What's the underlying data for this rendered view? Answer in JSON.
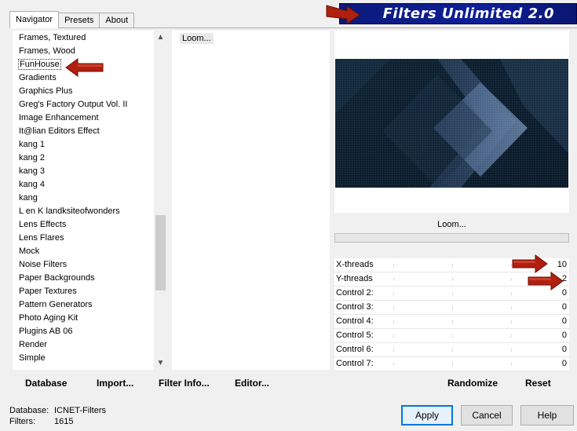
{
  "title": "Filters Unlimited 2.0",
  "tabs": [
    {
      "label": "Navigator",
      "active": true
    },
    {
      "label": "Presets",
      "active": false
    },
    {
      "label": "About",
      "active": false
    }
  ],
  "categories": [
    "Frames, Textured",
    "Frames, Wood",
    "FunHouse",
    "Gradients",
    "Graphics Plus",
    "Greg's Factory Output Vol. II",
    "Image Enhancement",
    "It@lian Editors Effect",
    "kang 1",
    "kang 2",
    "kang 3",
    "kang 4",
    "kang",
    "L en K landksiteofwonders",
    "Lens Effects",
    "Lens Flares",
    "Mock",
    "Noise Filters",
    "Paper Backgrounds",
    "Paper Textures",
    "Pattern Generators",
    "Photo Aging Kit",
    "Plugins AB 06",
    "Render",
    "Simple"
  ],
  "selected_category": "FunHouse",
  "filters": [
    "Loom..."
  ],
  "selected_filter": "Loom...",
  "filter_name_display": "Loom...",
  "controls": [
    {
      "label": "X-threads",
      "value": "10"
    },
    {
      "label": "Y-threads",
      "value": "2"
    },
    {
      "label": "Control 2:",
      "value": "0"
    },
    {
      "label": "Control 3:",
      "value": "0"
    },
    {
      "label": "Control 4:",
      "value": "0"
    },
    {
      "label": "Control 5:",
      "value": "0"
    },
    {
      "label": "Control 6:",
      "value": "0"
    },
    {
      "label": "Control 7:",
      "value": "0"
    }
  ],
  "left_buttons": {
    "database": "Database",
    "import": "Import...",
    "filter_info": "Filter Info...",
    "editor": "Editor..."
  },
  "right_buttons": {
    "randomize": "Randomize",
    "reset": "Reset"
  },
  "status": {
    "database_label": "Database:",
    "database_value": "ICNET-Filters",
    "filters_label": "Filters:",
    "filters_value": "1615"
  },
  "dialog_buttons": {
    "apply": "Apply",
    "cancel": "Cancel",
    "help": "Help"
  },
  "colors": {
    "title_bar": "#0e1f9a",
    "arrow": "#b0200f",
    "preview_dark": "#0e1f30",
    "preview_light": "#5c7396"
  }
}
